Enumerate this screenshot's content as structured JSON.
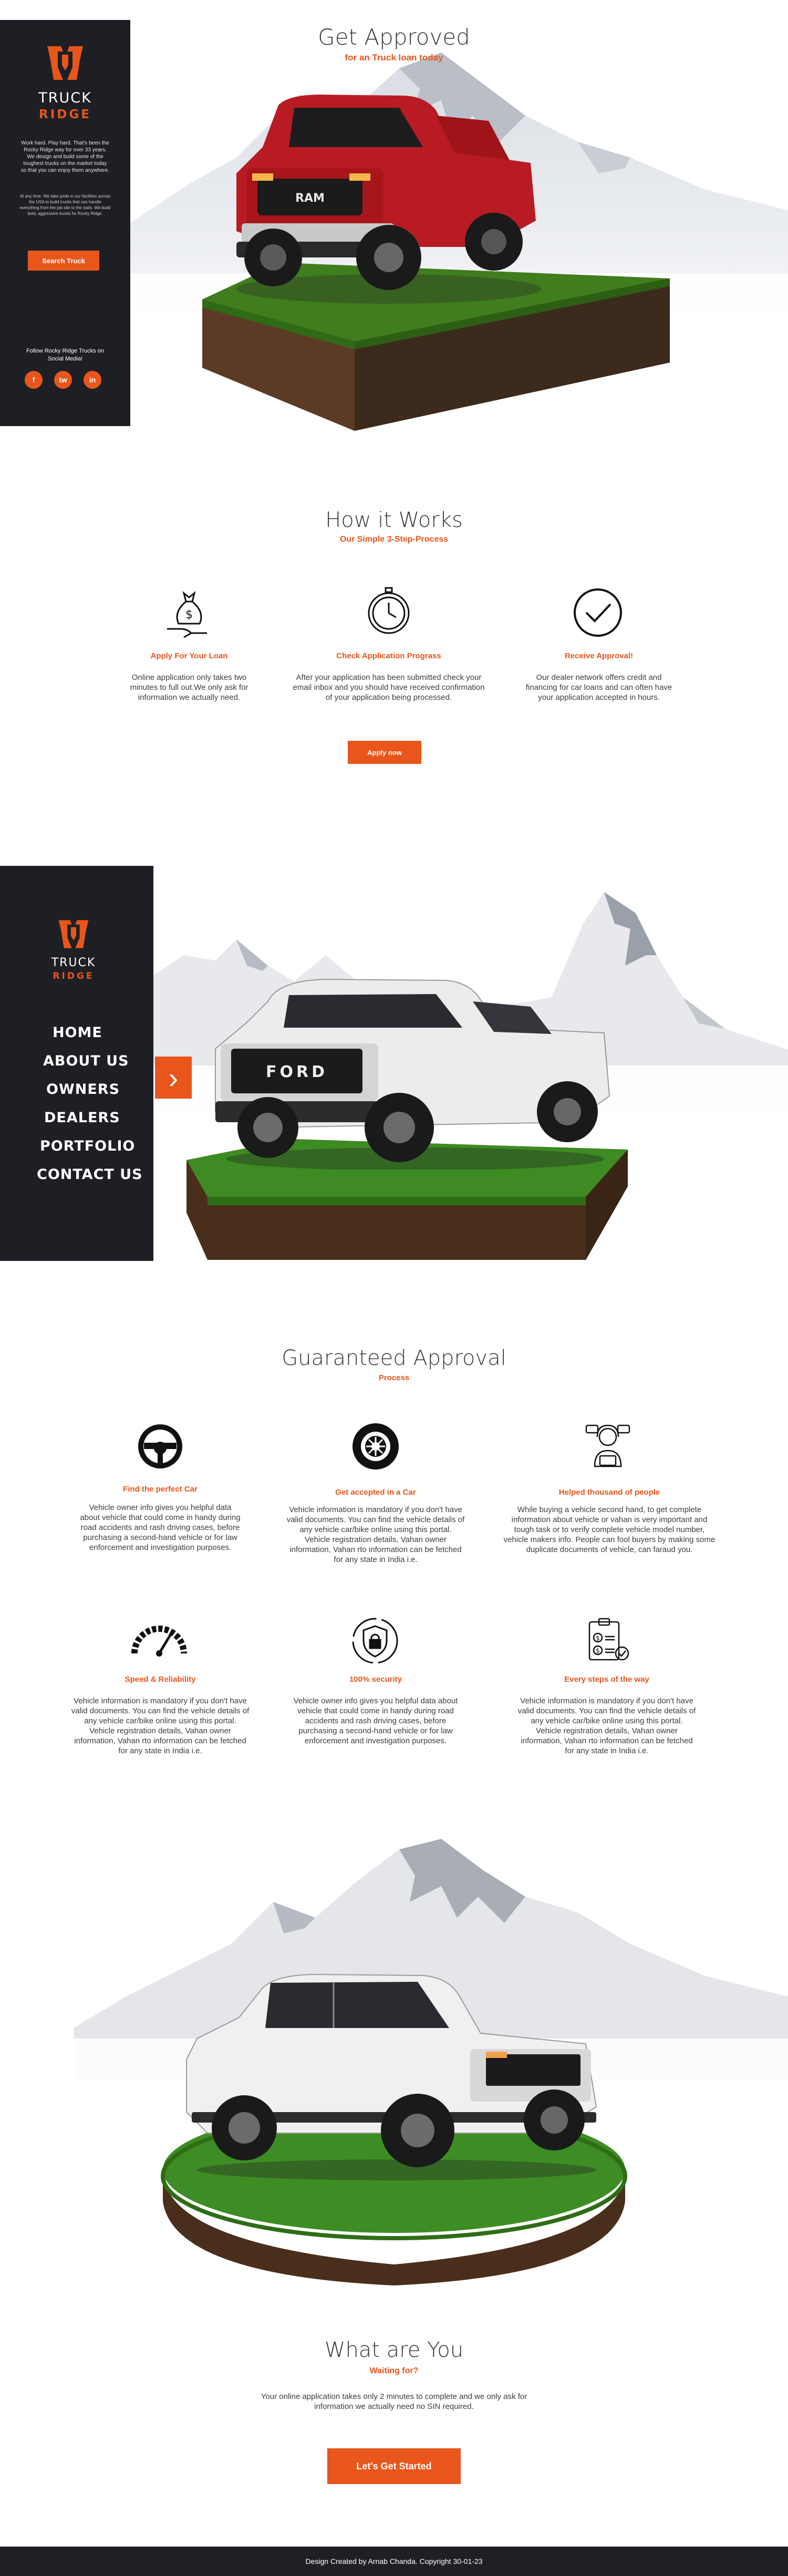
{
  "hero": {
    "title": "Get Approved",
    "subtitle": "for an Truck loan today",
    "brand_line1": "TRUCK",
    "brand_line2": "RIDGE",
    "para1": "Work hard. Play hard. That's been the Rocky Ridge way for over 33 years. We design and build some of the toughest trucks on the market today so that you can enjoy them anywhere.",
    "para2": "At any time. We take pride in our facilities across the USA to build trucks that can handle everything from the job site to the trails. We build bold, aggressive trucks for Rocky Ridge.",
    "search_button": "Search Truck",
    "follow_text": "Follow Rocky Ridge Trucks on Social Media!",
    "social": [
      "f",
      "tw",
      "in"
    ],
    "truck_grille_text": "RAM"
  },
  "how": {
    "title": "How it Works",
    "subtitle": "Our Simple 3-Step-Process",
    "steps": [
      {
        "title": "Apply  For Your Loan",
        "text": "Online application only takes two minutes to full out.We only ask for information we actually need."
      },
      {
        "title": "Check Application Prograss",
        "text": "After your application has been submitted check your email inbox and you should have received confirmation of your application being processed."
      },
      {
        "title": "Receive Approval!",
        "text": "Our dealer network offers credit and financing for car loans and can often have your application accepted in hours."
      }
    ],
    "button": "Apply now"
  },
  "menu": {
    "brand_line1": "TRUCK",
    "brand_line2": "RIDGE",
    "links": [
      "HOME",
      "ABOUT US",
      "OWNERS",
      "DEALERS",
      "PORTFOLIO",
      "CONTACT US"
    ],
    "toggle": "›",
    "truck_grille_text": "FORD"
  },
  "guarantee": {
    "title": "Guaranteed Approval",
    "subtitle": "Process",
    "features": [
      {
        "icon": "steering-wheel-icon",
        "title": "Find the perfect Car",
        "text": "Vehicle owner info gives you helpful data about vehicle that could come in handy during road accidents and rash driving cases, before purchasing a second-hand vehicle or for law enforcement and investigation purposes."
      },
      {
        "icon": "tyre-icon",
        "title": "Get accepted in a Car",
        "text": "Vehicle information is mandatory if you don't have valid documents. You can find the vehicle details of any vehicle car/bike online using this portal. Vehicle registration details, Vahan owner information, Vahan rto information can be fetched for any state in India i.e."
      },
      {
        "icon": "support-agent-icon",
        "title": "Helped thousand of people",
        "text": "While buying a vehicle second hand, to get complete information about vehicle or vahan is very important and tough task or to verify complete vehicle model number, vehicle makers info. People can fool buyers by making some duplicate documents of vehicle, can faraud you."
      },
      {
        "icon": "speedometer-icon",
        "title": "Speed & Reliability",
        "text": "Vehicle information is mandatory if you don't have valid documents. You can find the vehicle details of any vehicle car/bike online using this portal. Vehicle registration details, Vahan owner information, Vahan rto information can be fetched for any state in India i.e."
      },
      {
        "icon": "security-lock-icon",
        "title": "100% security",
        "text": "Vehicle owner info gives you helpful data about vehicle that could come in handy during road accidents and rash driving cases, before purchasing a second-hand vehicle or for law enforcement and investigation purposes."
      },
      {
        "icon": "checklist-icon",
        "title": "Every steps of the way",
        "text": "Vehicle information is mandatory if you don't have valid documents. You can find the vehicle details of any vehicle car/bike online using this portal. Vehicle registration details, Vahan owner information, Vahan rto information can be fetched for any state in India i.e."
      }
    ]
  },
  "cta": {
    "title": "What are You",
    "subtitle": "Waiting for?",
    "text": "Your online application takes only 2 minutes to complete and we only ask for information we actually need no SIN required.",
    "button": "Let's Get Started"
  },
  "footer": {
    "text": "Design Created by Arnab Chanda. Copyright 30-01-23"
  }
}
